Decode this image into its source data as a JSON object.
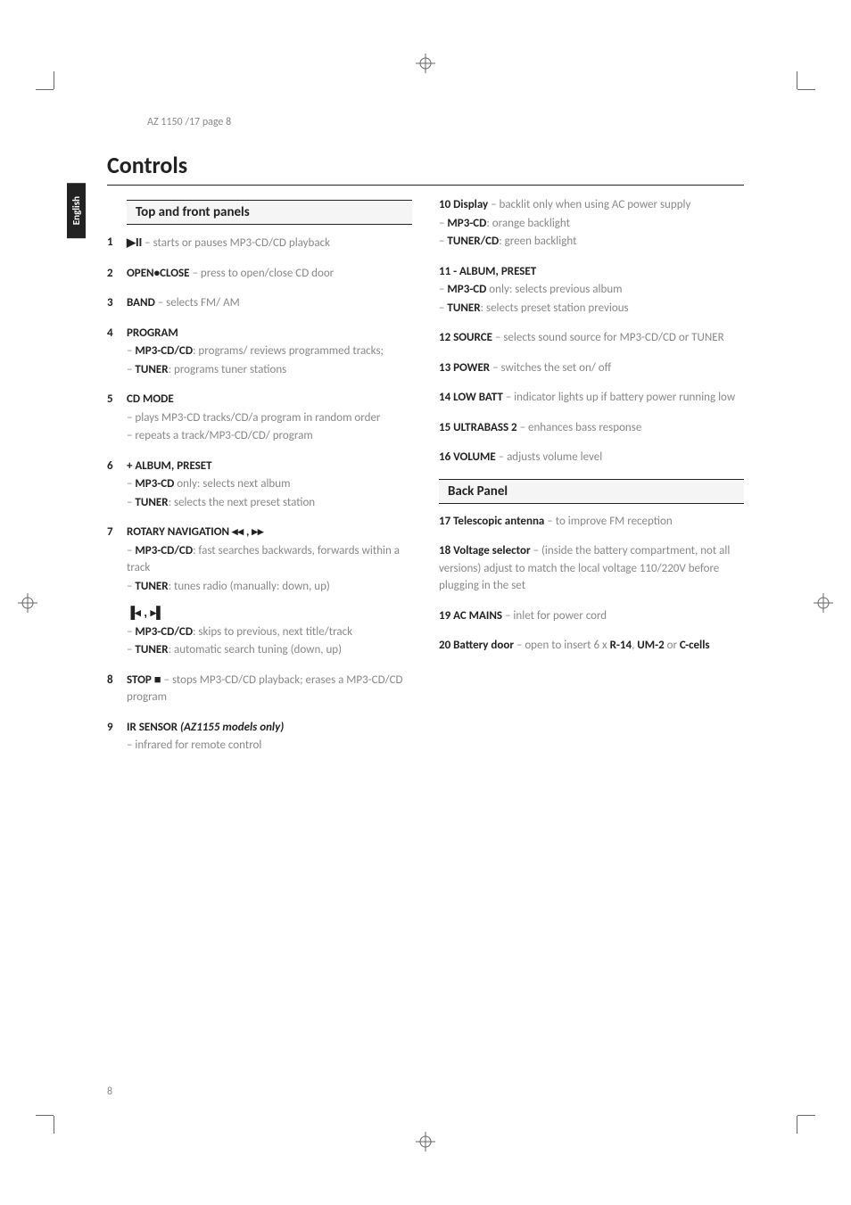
{
  "header": "AZ 1150 /17  page 8",
  "tab_label": "English",
  "page_title": "Controls",
  "section_top": "Top and front panels",
  "section_back": "Back Panel",
  "left_items": [
    {
      "num": "1",
      "title_glyph": "▶II",
      "desc": " – starts or pauses MP3-CD/CD playback"
    },
    {
      "num": "2",
      "title": "OPEN•CLOSE",
      "desc": " – press to open/close CD door"
    },
    {
      "num": "3",
      "title": "BAND",
      "desc": " – selects FM/ AM"
    },
    {
      "num": "4",
      "title": "PROGRAM",
      "subs": [
        {
          "b": "MP3-CD/CD",
          "t": ": programs/ reviews programmed tracks;"
        },
        {
          "b": "TUNER",
          "t": ": programs tuner stations"
        }
      ]
    },
    {
      "num": "5",
      "title": "CD MODE",
      "plain": [
        "– plays MP3-CD tracks/CD/a program in random order",
        "– repeats a track/MP3-CD/CD/ program"
      ]
    },
    {
      "num": "6",
      "title": "+ ALBUM, PRESET",
      "subs": [
        {
          "b": "MP3-CD",
          "t": " only: selects next album"
        },
        {
          "b": "TUNER",
          "t": ": selects the next preset station"
        }
      ]
    },
    {
      "num": "7",
      "title": "ROTARY NAVIGATION ◂◂ , ▸▸",
      "subs": [
        {
          "b": "MP3-CD/CD",
          "t": ": fast searches backwards, forwards within a track"
        },
        {
          "b": "TUNER",
          "t": ": tunes radio (manually: down, up)"
        }
      ],
      "extra_title": "▐◂ , ▸▌",
      "extra_subs": [
        {
          "b": "MP3-CD/CD",
          "t": ": skips to previous, next title/track"
        },
        {
          "b": "TUNER",
          "t": ": automatic search tuning (down, up)"
        }
      ]
    },
    {
      "num": "8",
      "title": "STOP ■",
      "desc": " – stops MP3-CD/CD playback; erases a MP3-CD/CD program"
    },
    {
      "num": "9",
      "title": "IR SENSOR",
      "title_italic": " (AZ1155 models only)",
      "plain": [
        "– infrared for remote control"
      ]
    }
  ],
  "right_items": [
    {
      "num": "",
      "title": "10 Display",
      "desc": " – backlit only when using AC power supply",
      "subs": [
        {
          "b": "MP3-CD",
          "t": ": orange backlight"
        },
        {
          "b": "TUNER/CD",
          "t": ": green backlight"
        }
      ]
    },
    {
      "num": "",
      "title": "11 - ALBUM, PRESET",
      "subs": [
        {
          "b": "MP3-CD",
          "t": " only: selects previous album"
        },
        {
          "b": "TUNER",
          "t": ": selects preset station previous"
        }
      ]
    },
    {
      "num": "",
      "title": "12 SOURCE",
      "desc": " – selects sound source for MP3-CD/CD or TUNER"
    },
    {
      "num": "",
      "title": "13 POWER",
      "desc": " – switches the set on/ off"
    },
    {
      "num": "",
      "title": "14 LOW BATT",
      "desc": " – indicator lights up if battery power running low"
    },
    {
      "num": "",
      "title": "15 ULTRABASS 2",
      "desc": " – enhances bass response"
    },
    {
      "num": "",
      "title": "16 VOLUME",
      "desc": " – adjusts volume level"
    }
  ],
  "back_items": [
    {
      "title": "17 Telescopic antenna",
      "desc": " – to improve FM reception"
    },
    {
      "title": "18 Voltage selector",
      "desc": " – (inside the battery compartment, not all versions) adjust to match the local voltage 110/220V before plugging in the set"
    },
    {
      "title": "19 AC MAINS",
      "desc": " – inlet for power cord"
    },
    {
      "title": "20 Battery door",
      "desc": " – open to insert 6 x ",
      "extra": [
        {
          "b": "R-14",
          "t": ", "
        },
        {
          "b": "UM-2",
          "t": " or "
        },
        {
          "b": "C-cells",
          "t": ""
        }
      ]
    }
  ],
  "page_number": "8"
}
